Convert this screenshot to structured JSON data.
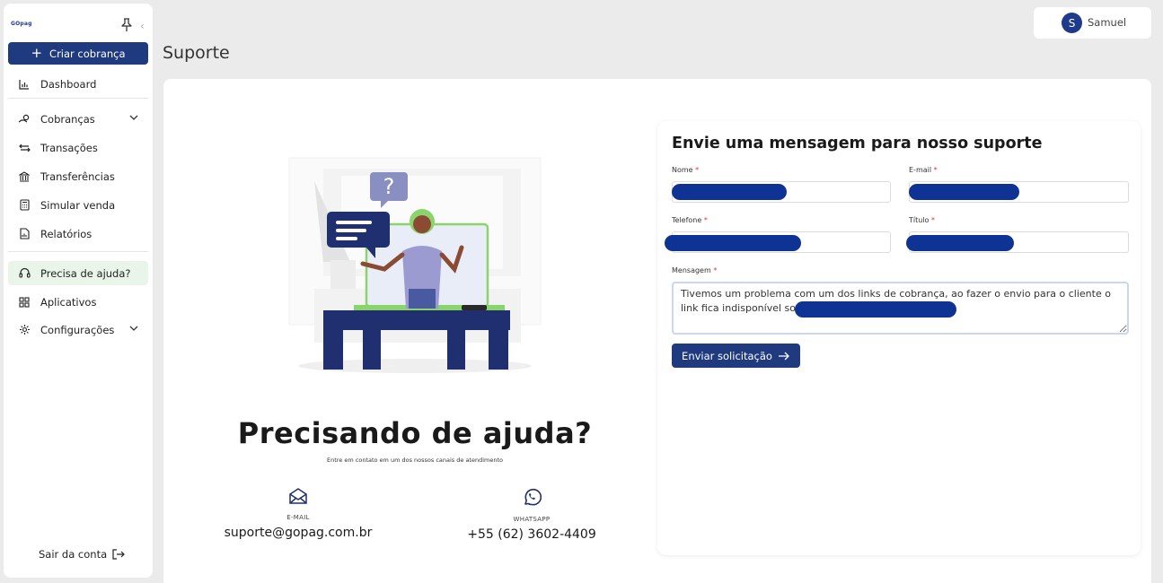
{
  "sidebar": {
    "logo": "GOpag",
    "create_button": "Criar cobrança",
    "items": [
      {
        "label": "Dashboard",
        "icon": "chart-bar-icon"
      },
      {
        "label": "Cobranças",
        "icon": "hand-coin-icon"
      },
      {
        "label": "Transações",
        "icon": "arrows-exchange-icon"
      },
      {
        "label": "Transferências",
        "icon": "bank-icon"
      },
      {
        "label": "Simular venda",
        "icon": "calculator-icon"
      },
      {
        "label": "Relatórios",
        "icon": "report-icon"
      },
      {
        "label": "Precisa de ajuda?",
        "icon": "headset-icon"
      },
      {
        "label": "Aplicativos",
        "icon": "grid-icon"
      },
      {
        "label": "Configurações",
        "icon": "gear-icon"
      }
    ],
    "logout": "Sair da conta"
  },
  "header": {
    "user_initial": "S",
    "user_name": "Samuel",
    "page_title": "Suporte"
  },
  "help": {
    "title": "Precisando de ajuda?",
    "subtitle": "Entre em contato em um dos nossos canais de atendimento",
    "email_label": "E-MAIL",
    "email_value": "suporte@gopag.com.br",
    "whatsapp_label": "WHATSAPP",
    "whatsapp_value": "+55 (62) 3602-4409"
  },
  "form": {
    "title": "Envie uma mensagem para nosso suporte",
    "name_label": "Nome",
    "email_label": "E-mail",
    "phone_label": "Telefone",
    "subject_label": "Título",
    "required_mark": "*",
    "message_label": "Mensagem",
    "message_value": "Tivemos um problema com um dos links de cobrança, ao fazer o envio para o cliente o link fica indisponível soment",
    "submit_label": "Enviar solicitação"
  },
  "colors": {
    "primary": "#1f3a7f",
    "redaction": "#0f3394",
    "active_bg": "#e8f5e8",
    "illustration_green": "#8bd36b"
  }
}
